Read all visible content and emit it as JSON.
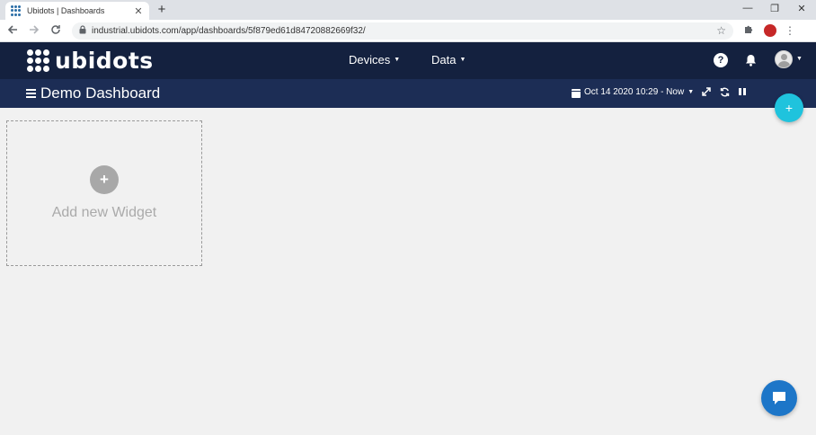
{
  "browser": {
    "tab_title": "Ubidots | Dashboards",
    "tab_close": "✕",
    "new_tab": "+",
    "url": "industrial.ubidots.com/app/dashboards/5f879ed61d84720882669f32/",
    "window_controls": {
      "minimize": "—",
      "maximize": "❐",
      "close": "✕"
    },
    "icons": {
      "back": "arrow-left-icon",
      "forward": "arrow-right-icon",
      "reload": "reload-icon",
      "lock": "lock-icon",
      "star": "star-icon",
      "extensions": "puzzle-icon",
      "menu": "more-vert-icon"
    }
  },
  "header": {
    "logo_text": "ubidots",
    "nav": [
      {
        "label": "Devices"
      },
      {
        "label": "Data"
      }
    ],
    "icons": {
      "help": "help-icon",
      "notifications": "bell-icon",
      "user": "avatar"
    }
  },
  "dashboard": {
    "title": "Demo Dashboard",
    "date_range": "Oct 14 2020 10:29 - Now",
    "icons": {
      "menu": "hamburger-icon",
      "calendar": "calendar-icon",
      "fullscreen": "expand-icon",
      "refresh": "refresh-icon",
      "pause": "pause-icon"
    }
  },
  "add_widget": {
    "label": "Add new Widget",
    "icon": "+"
  },
  "fab": {
    "icon": "+"
  },
  "colors": {
    "app_header": "#14213f",
    "dashboard_bar": "#1c2d55",
    "fab": "#1fc3dd",
    "chat": "#1d76c8",
    "background": "#f1f1f1"
  }
}
